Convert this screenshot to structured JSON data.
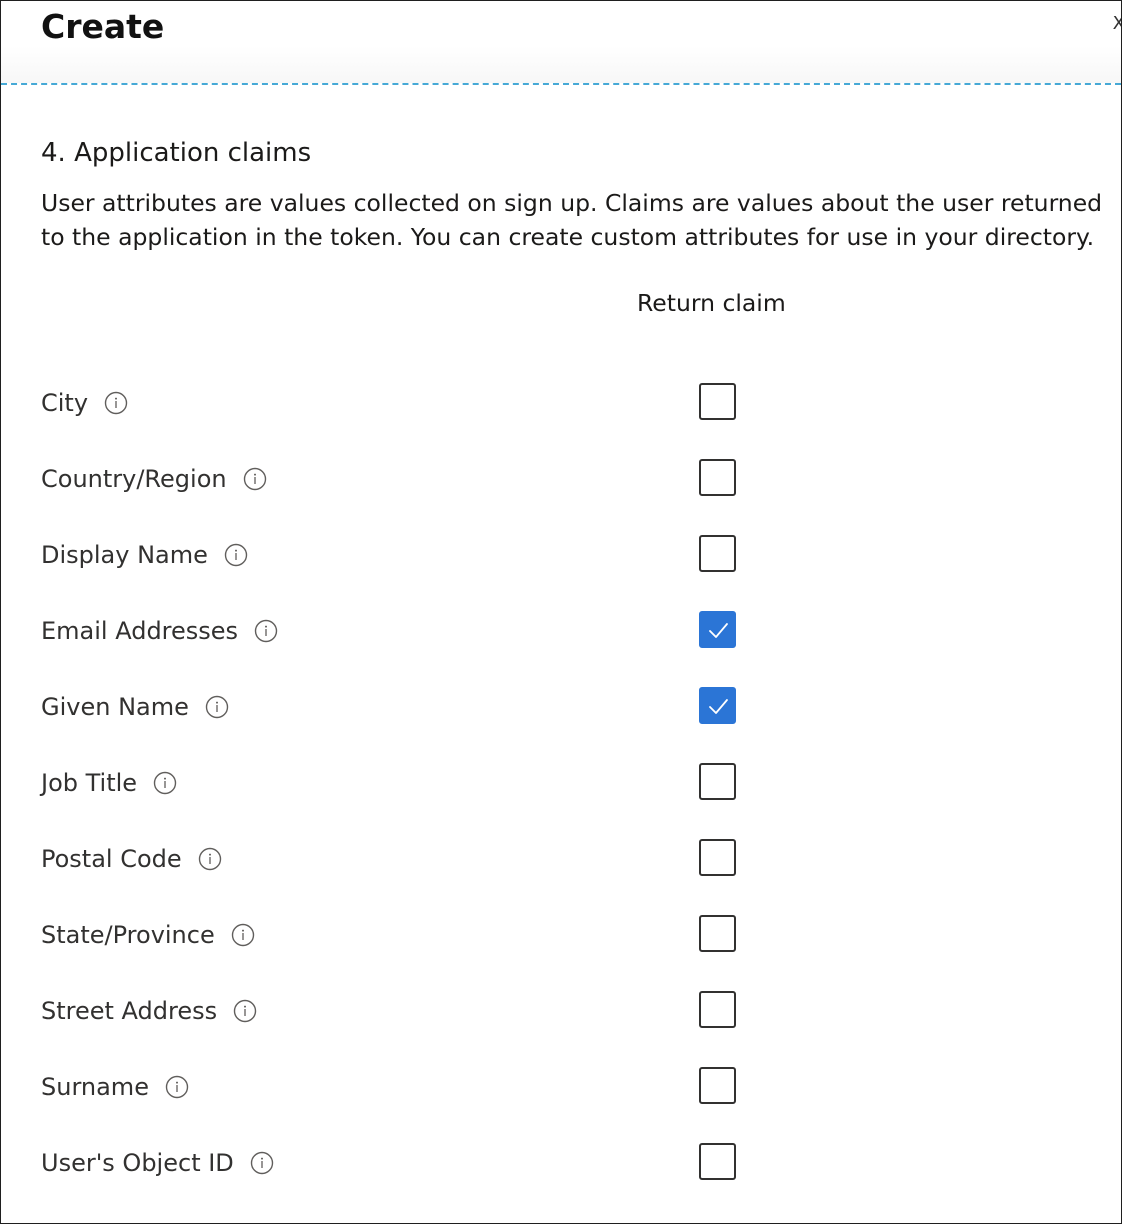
{
  "header": {
    "title": "Create",
    "close_glyph": "X"
  },
  "section": {
    "heading": "4. Application claims",
    "description": "User attributes are values collected on sign up. Claims are values about the user returned to the application in the token. You can create custom attributes for use in your directory.",
    "column_header": "Return claim"
  },
  "claims": [
    {
      "label": "City",
      "checked": false
    },
    {
      "label": "Country/Region",
      "checked": false
    },
    {
      "label": "Display Name",
      "checked": false
    },
    {
      "label": "Email Addresses",
      "checked": true
    },
    {
      "label": "Given Name",
      "checked": true
    },
    {
      "label": "Job Title",
      "checked": false
    },
    {
      "label": "Postal Code",
      "checked": false
    },
    {
      "label": "State/Province",
      "checked": false
    },
    {
      "label": "Street Address",
      "checked": false
    },
    {
      "label": "Surname",
      "checked": false
    },
    {
      "label": "User's Object ID",
      "checked": false
    }
  ],
  "colors": {
    "checked_accent": "#2b75d6",
    "header_divider": "#46a9d6"
  },
  "icons": {
    "info": "info-circle-icon",
    "check": "checkmark-icon",
    "close": "close-icon"
  }
}
